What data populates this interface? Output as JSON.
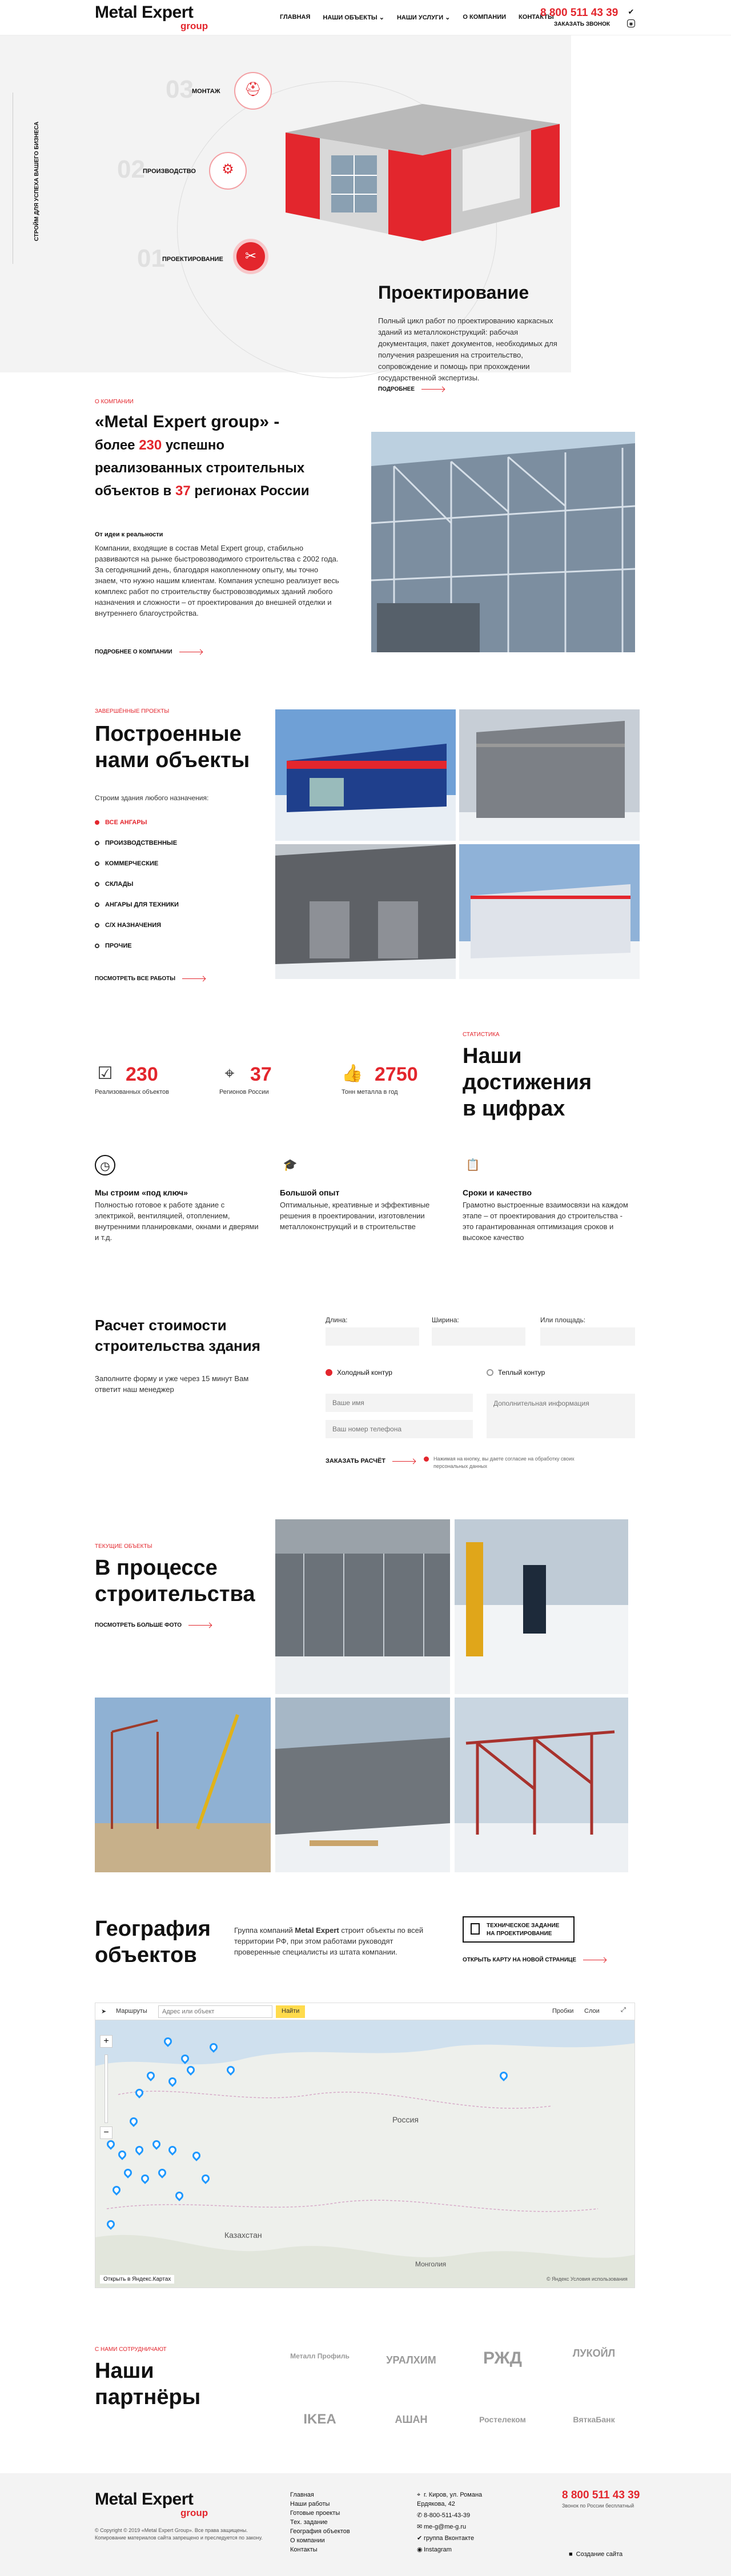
{
  "header": {
    "logo_main": "Metal Expert",
    "logo_sub": "group",
    "nav": [
      "Главная",
      "Наши объекты ⌄",
      "Наши услуги ⌄",
      "О компании",
      "Контакты"
    ],
    "phone": "8 800 511 43 39",
    "callback": "Заказать звонок"
  },
  "hero": {
    "vertical_text": "Стройм для успеха вашего бизнеса",
    "steps": [
      {
        "num": "03",
        "label": "Монтаж"
      },
      {
        "num": "02",
        "label": "Производство"
      },
      {
        "num": "01",
        "label": "Проектирование"
      }
    ],
    "title": "Проектирование",
    "text": "Полный цикл работ по проектированию каркасных зданий из металлоконструкций: рабочая документация, пакет документов, необходимых для получения разрешения на строительство, сопровождение и помощь при прохождении государственной экспертизы.",
    "more": "Подробнее"
  },
  "about": {
    "label": "О компании",
    "title_a": "«Metal Expert group» -",
    "title_b": "более",
    "num1": "230",
    "title_c": "успешно",
    "title_d": "реализованных строительных",
    "title_e": "объектов в",
    "num2": "37",
    "title_f": "регионах России",
    "sub": "От идеи к реальности",
    "text": "Компании, входящие в состав Metal Expert group, стабильно развиваются на рынке быстровозводимого строительства с 2002 года. За сегодняшний день, благодаря накопленному опыту, мы точно знаем, что нужно нашим клиентам. Компания успешно реализует весь комплекс работ по строительству быстровозводимых зданий любого назначения и сложности – от проектирования до внешней отделки и внутреннего благоустройства.",
    "more": "Подробнее о компании"
  },
  "projects": {
    "label": "Завершённые проекты",
    "title_a": "Построенные",
    "title_b": "нами объекты",
    "sub": "Строим здания любого назначения:",
    "filters": [
      "Все ангары",
      "Производственные",
      "Коммерческие",
      "Склады",
      "Ангары для техники",
      "С/х назначения",
      "Прочие"
    ],
    "more": "Посмотреть все работы"
  },
  "achievements": {
    "label": "Статистика",
    "title_a": "Наши",
    "title_b": "достижения",
    "title_c": "в цифрах",
    "stats": [
      {
        "num": "230",
        "label": "Реализованных объектов"
      },
      {
        "num": "37",
        "label": "Регионов России"
      },
      {
        "num": "2750",
        "label": "Тонн металла в год"
      }
    ],
    "features": [
      {
        "title": "Мы строим «под ключ»",
        "text": "Полностью готовое к работе здание с электрикой, вентиляцией, отоплением, внутренними планировками, окнами и дверями и т.д."
      },
      {
        "title": "Большой опыт",
        "text": "Оптимальные, креативные и эффективные решения в проектировании, изготовлении металлоконструкций и в строительстве"
      },
      {
        "title": "Сроки и качество",
        "text": "Грамотно выстроенные взаимосвязи на каждом этапе – от проектирования до строительства - это гарантированная оптимизация сроков и высокое качество"
      }
    ]
  },
  "calc": {
    "title_a": "Расчет стоимости",
    "title_b": "строительства здания",
    "text": "Заполните форму и уже через 15 минут Вам ответит наш менеджер",
    "length_label": "Длина:",
    "width_label": "Ширина:",
    "area_label": "Или площадь:",
    "cold": "Холодный контур",
    "warm": "Теплый контур",
    "name_ph": "Ваше имя",
    "phone_ph": "Ваш номер телефона",
    "info_ph": "Дополнительная информация",
    "submit": "Заказать расчёт",
    "consent": "Нажимая на кнопку, вы даете согласие на обработку своих персональных данных"
  },
  "progress": {
    "label": "Текущие объекты",
    "title_a": "В процессе",
    "title_b": "строительства",
    "more": "Посмотреть больше фото"
  },
  "geo": {
    "title_a": "География",
    "title_b": "объектов",
    "text_a": "Группа компаний",
    "text_brand": "Metal Expert",
    "text_b": "строит объекты по всей территории РФ, при этом работами руководят проверенные специалисты из штата компании.",
    "tz": "Техническое задание на проектирование",
    "open_map": "Открыть карту на новой странице"
  },
  "map": {
    "routes": "Маршруты",
    "search_ph": "Адрес или объект",
    "find": "Найти",
    "traffic": "Пробки",
    "layers": "Слои",
    "russia": "Россия",
    "kz": "Казахстан",
    "mongolia": "Монголия",
    "open_ya": "Открыть в Яндекс.Картах",
    "terms": "© Яндекс Условия использования"
  },
  "partners": {
    "label": "С нами сотрудничают",
    "title_a": "Наши",
    "title_b": "партнёры",
    "logos": [
      "Металл Профиль",
      "УРАЛХИМ",
      "РЖД",
      "ЛУКОЙЛ",
      "IKEA",
      "АШАН",
      "Ростелеком",
      "ВяткаБанк"
    ]
  },
  "footer": {
    "copyright": "© Copyright © 2019 «Metal Expert Group». Все права защищены. Копирование материалов сайта запрещено и преследуется по закону.",
    "links": [
      "Главная",
      "Наши работы",
      "Готовые проекты",
      "Тех. задание",
      "География объектов",
      "О компании",
      "Контакты"
    ],
    "address": "г. Киров, ул. Романа Ердякова, 42",
    "phone": "8-800-511-43-39",
    "email": "me-g@me-g.ru",
    "vk": "группа Вконтакте",
    "insta": "Instagram",
    "phone_big": "8 800 511 43 39",
    "free": "Звонок по России бесплатный",
    "dev": "Создание сайта"
  },
  "colors": {
    "accent": "#e3262d",
    "dark": "#111111",
    "light_bg": "#f3f3f3"
  }
}
